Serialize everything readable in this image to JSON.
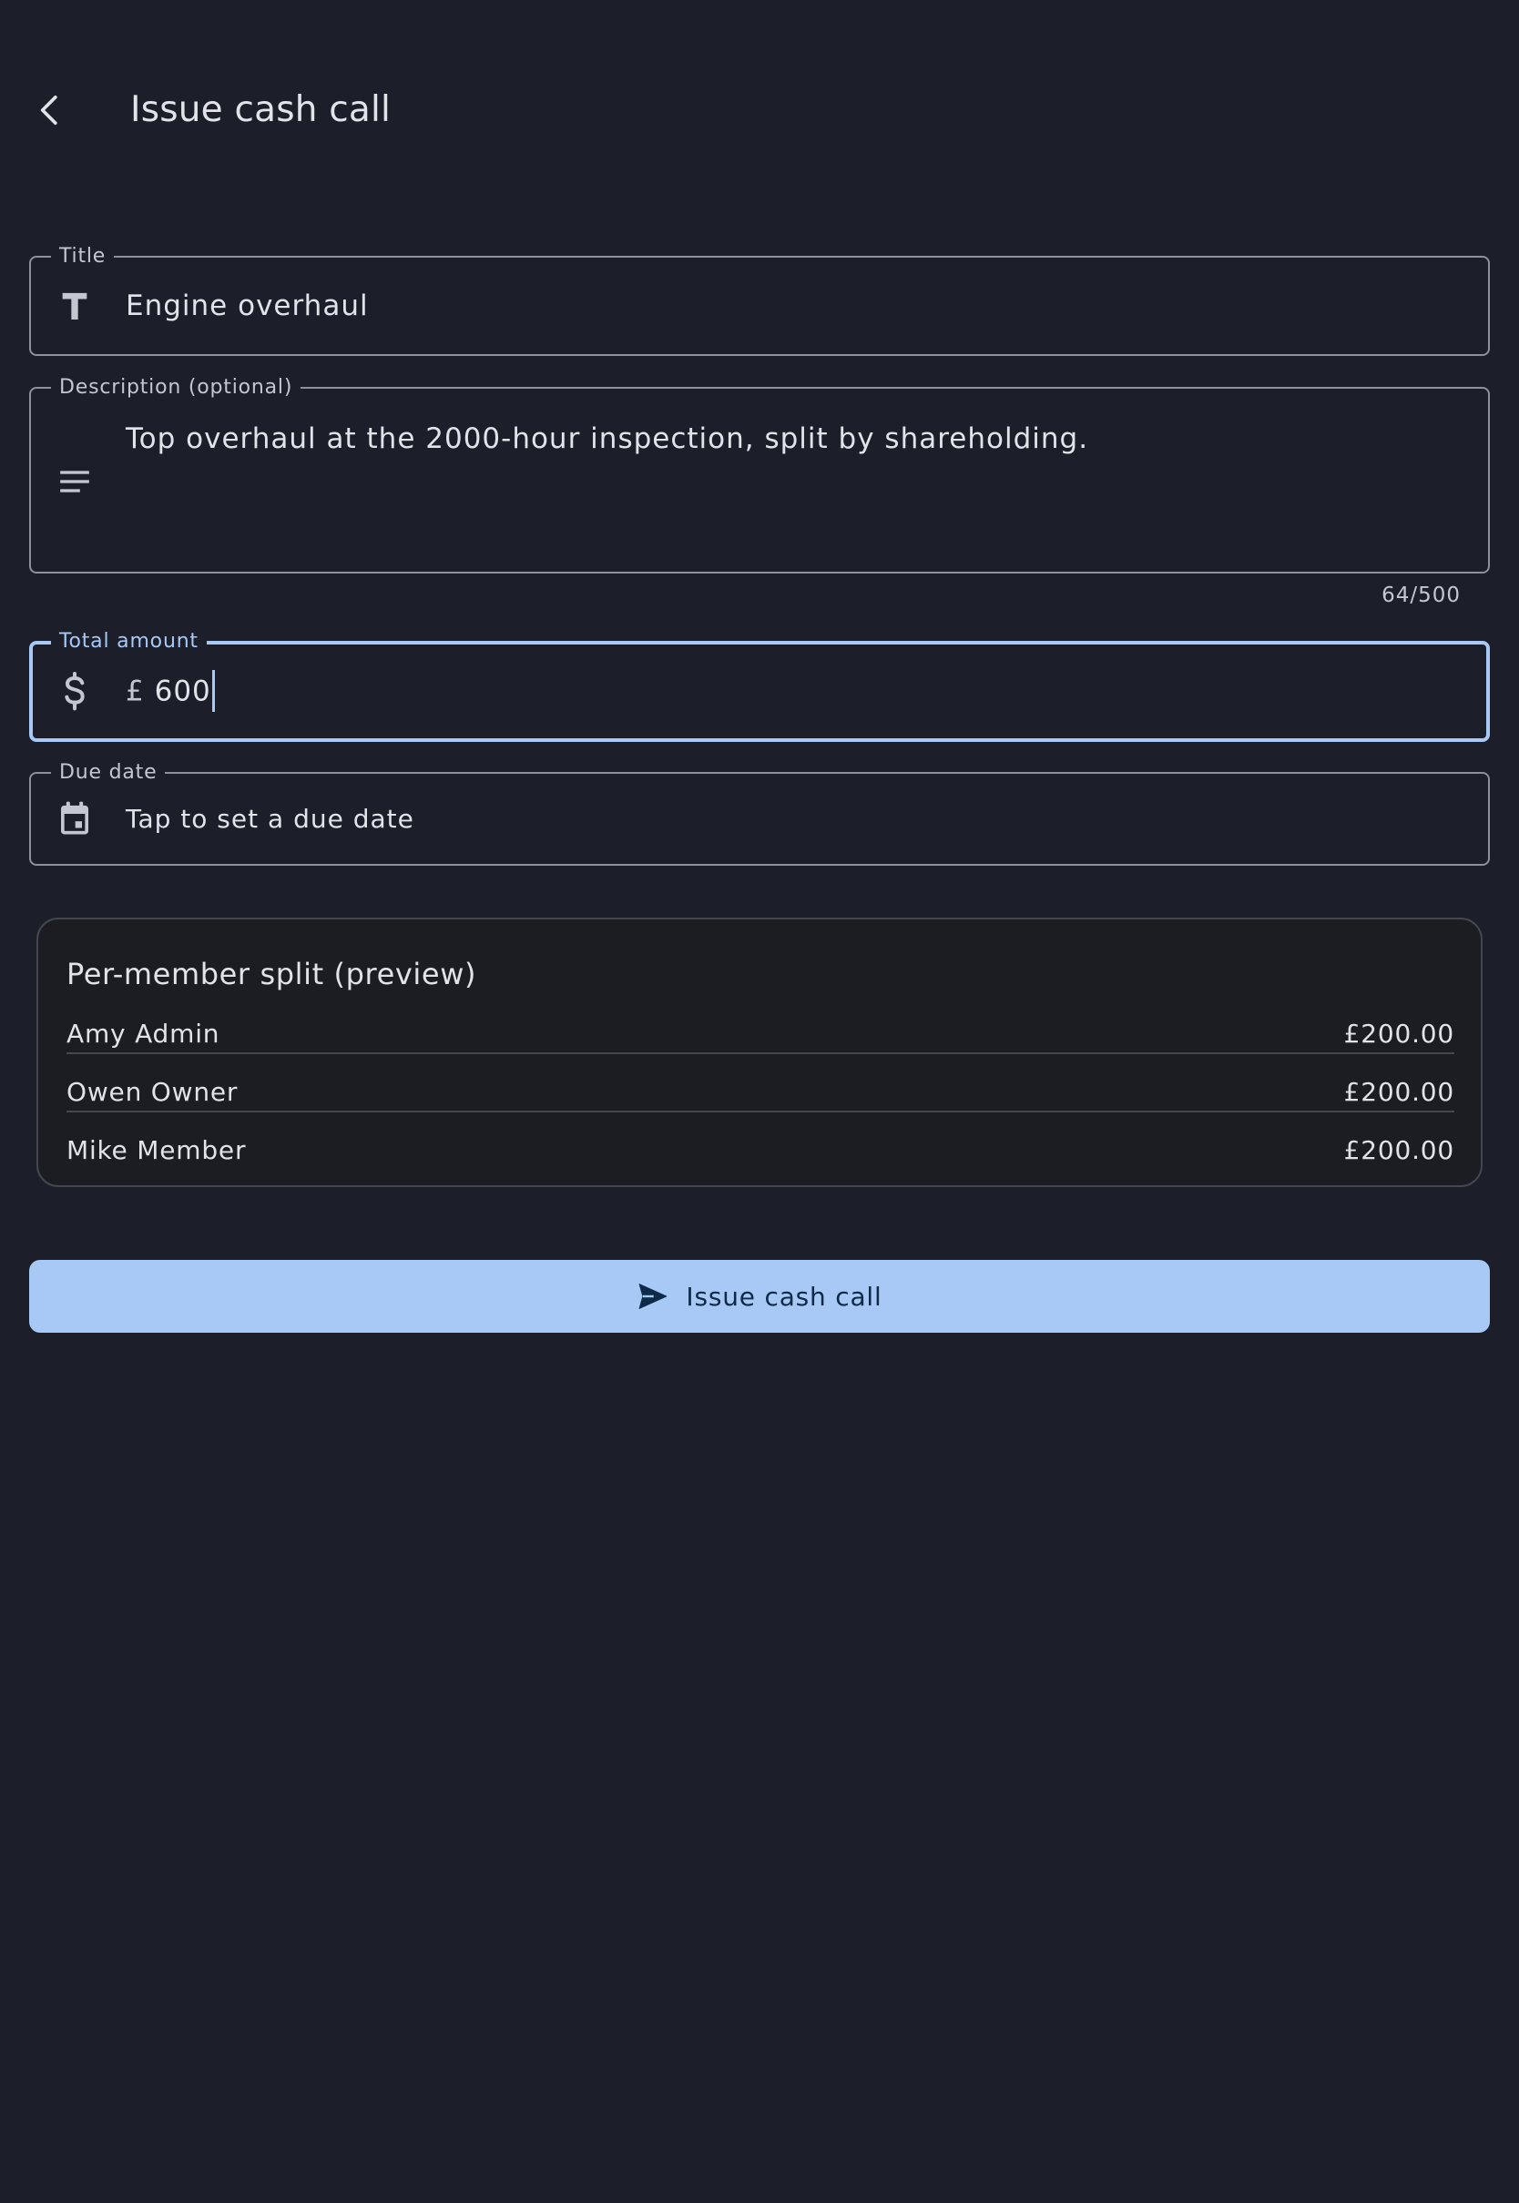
{
  "appbar": {
    "title": "Issue cash call",
    "back_icon": "chevron-left-icon"
  },
  "form": {
    "title_field": {
      "label": "Title",
      "value": "Engine overhaul",
      "icon": "title-text-icon"
    },
    "description_field": {
      "label": "Description (optional)",
      "value": "Top overhaul at the 2000-hour inspection, split by shareholding.",
      "counter": "64/500",
      "icon": "notes-icon"
    },
    "amount_field": {
      "label": "Total amount",
      "prefix": "£",
      "value": "600",
      "icon": "dollar-icon",
      "focused": true
    },
    "due_date_field": {
      "label": "Due date",
      "placeholder": "Tap to set a due date",
      "icon": "calendar-icon"
    }
  },
  "split_preview": {
    "title": "Per-member split (preview)",
    "rows": [
      {
        "name": "Amy Admin",
        "amount": "£200.00"
      },
      {
        "name": "Owen Owner",
        "amount": "£200.00"
      },
      {
        "name": "Mike Member",
        "amount": "£200.00"
      }
    ]
  },
  "submit": {
    "label": "Issue cash call",
    "icon": "send-icon"
  },
  "colors": {
    "background": "#1c1f2a",
    "accent": "#a8c8f5",
    "outline": "#8e909a"
  }
}
